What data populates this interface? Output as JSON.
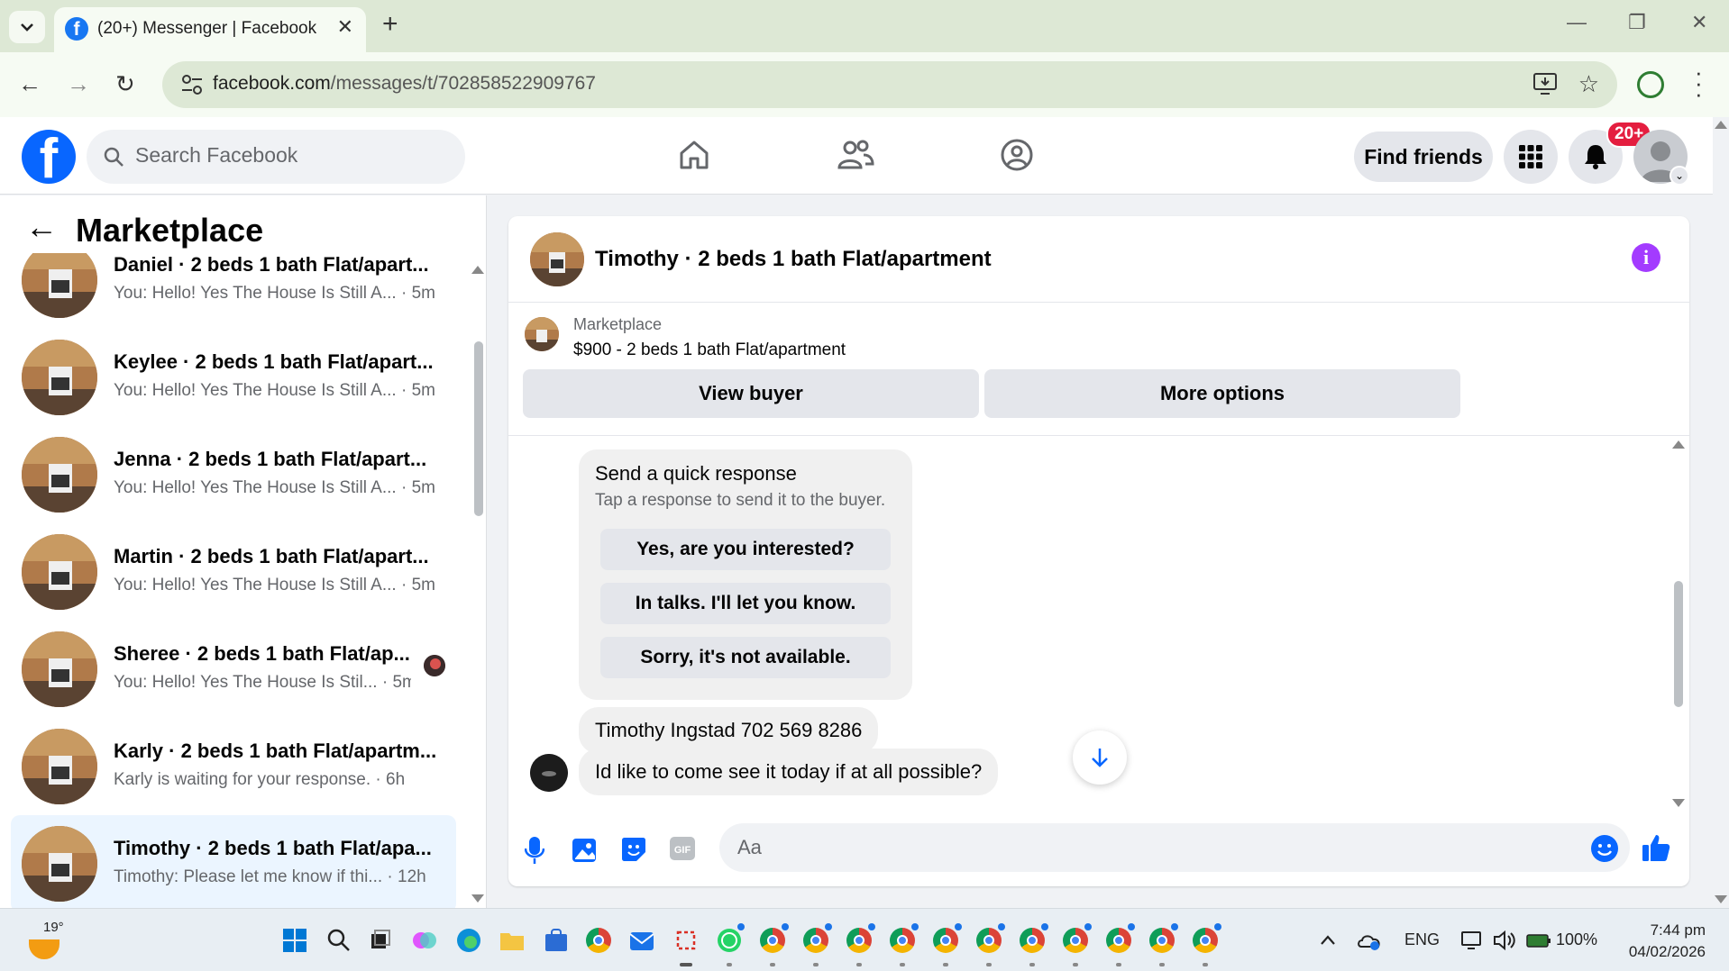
{
  "browser": {
    "tab_title": "(20+) Messenger | Facebook",
    "url_host": "facebook.com",
    "url_path": "/messages/t/702858522909767"
  },
  "header": {
    "search_placeholder": "Search Facebook",
    "find_friends_label": "Find friends",
    "notification_count": "20+"
  },
  "sidebar": {
    "title": "Marketplace",
    "conversations": [
      {
        "name": "Daniel · 2 beds 1 bath Flat/apart...",
        "preview": "You: Hello! Yes The House Is Still A... · 5m"
      },
      {
        "name": "Keylee · 2 beds 1 bath Flat/apart...",
        "preview": "You: Hello! Yes The House Is Still A... · 5m"
      },
      {
        "name": "Jenna · 2 beds 1 bath Flat/apart...",
        "preview": "You: Hello! Yes The House Is Still A... · 5m"
      },
      {
        "name": "Martin · 2 beds 1 bath Flat/apart...",
        "preview": "You: Hello! Yes The House Is Still A... · 5m"
      },
      {
        "name": "Sheree · 2 beds 1 bath Flat/ap...",
        "preview": "You: Hello! Yes The House Is Stil... · 5m"
      },
      {
        "name": "Karly · 2 beds 1 bath Flat/apartm...",
        "preview": "Karly is waiting for your response. · 6h"
      },
      {
        "name": "Timothy · 2 beds 1 bath Flat/apa...",
        "preview": "Timothy: Please let me know if thi... · 12h"
      }
    ]
  },
  "chat": {
    "title": "Timothy · 2 beds 1 bath Flat/apartment",
    "listing_source": "Marketplace",
    "listing_detail": "$900 - 2 beds 1 bath Flat/apartment",
    "view_buyer_label": "View buyer",
    "more_options_label": "More options",
    "quick_response": {
      "title": "Send a quick response",
      "subtitle": "Tap a response to send it to the buyer.",
      "options": [
        "Yes, are you interested?",
        "In talks. I'll let you know.",
        "Sorry, it's not available."
      ]
    },
    "messages": [
      "Timothy Ingstad 702 569 8286",
      "Id like to come see it today if at all possible?"
    ],
    "composer_placeholder": "Aa"
  },
  "taskbar": {
    "temperature": "19°",
    "language": "ENG",
    "battery": "100%",
    "time": "7:44 pm",
    "date": "04/02/2026"
  },
  "colors": {
    "facebook_blue": "#0866ff",
    "active_conversation": "#ebf5ff",
    "notification_red": "#e41e3f",
    "info_purple": "#a33bff"
  }
}
